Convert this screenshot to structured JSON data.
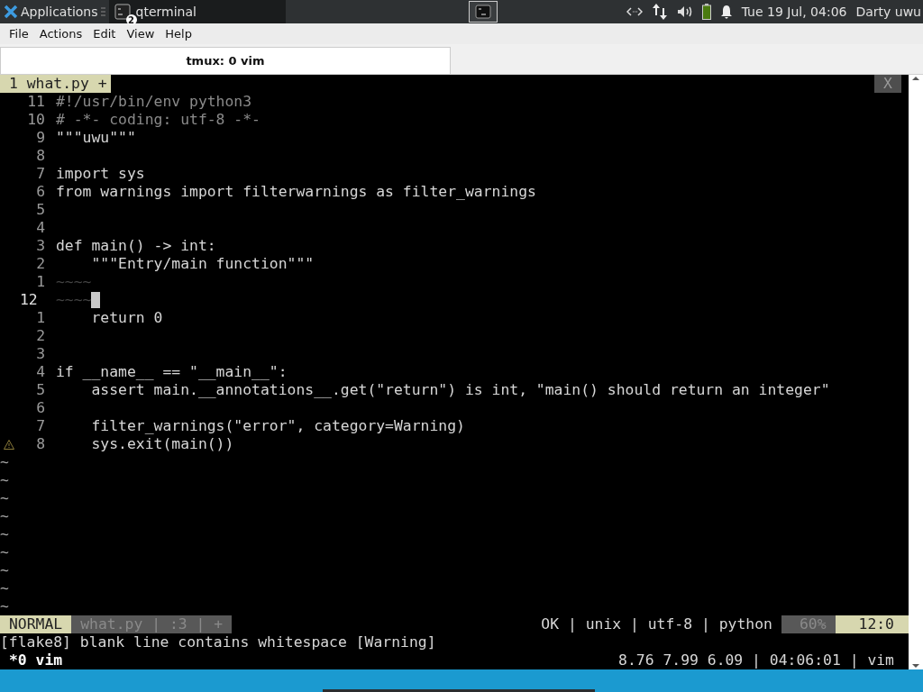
{
  "taskbar": {
    "menu_label": "Applications",
    "tasks": [
      {
        "label": "qterminal",
        "badge": "2",
        "selected": true
      }
    ],
    "clock": "Tue 19 Jul, 04:06",
    "user": "Darty uwu"
  },
  "window": {
    "menu": [
      "File",
      "Actions",
      "Edit",
      "View",
      "Help"
    ],
    "tabs": [
      {
        "label": "tmux: 0 vim",
        "selected": true
      }
    ]
  },
  "vim": {
    "buffer_tab": "1 what.py +",
    "close_label": "X",
    "lines": [
      {
        "number": "11",
        "text": "#!/usr/bin/env python3",
        "kind": "comment",
        "current": false
      },
      {
        "number": "10",
        "text": "# -*- coding: utf-8 -*-",
        "kind": "comment",
        "current": false
      },
      {
        "number": "9",
        "text": "\"\"\"uwu\"\"\"",
        "kind": "code",
        "current": false
      },
      {
        "number": "8",
        "current": false
      },
      {
        "number": "7",
        "text": "import sys",
        "kind": "code",
        "current": false
      },
      {
        "number": "6",
        "text": "from warnings import filterwarnings as filter_warnings",
        "kind": "code",
        "current": false
      },
      {
        "number": "5",
        "current": false
      },
      {
        "number": "4",
        "current": false
      },
      {
        "number": "3",
        "text": "def main() -> int:",
        "kind": "code",
        "current": false
      },
      {
        "number": "2",
        "text": "    \"\"\"Entry/main function\"\"\"",
        "kind": "code",
        "current": false
      },
      {
        "number": "1",
        "text": "~~~~",
        "kind": "whitespace",
        "current": false
      },
      {
        "number": "12",
        "text": "~~~~",
        "kind": "whitespace",
        "current": true
      },
      {
        "number": "1",
        "text": "    return 0",
        "kind": "code",
        "current": false
      },
      {
        "number": "2",
        "current": false
      },
      {
        "number": "3",
        "current": false
      },
      {
        "number": "4",
        "text": "if __name__ == \"__main__\":",
        "kind": "code",
        "current": false
      },
      {
        "number": "5",
        "text": "    assert main.__annotations__.get(\"return\") is int, \"main() should return an integer\"",
        "kind": "code",
        "current": false
      },
      {
        "number": "6",
        "current": false
      },
      {
        "number": "7",
        "text": "    filter_warnings(\"error\", category=Warning)",
        "kind": "code",
        "current": false
      },
      {
        "number": "8",
        "text": "    sys.exit(main())",
        "kind": "code",
        "current": false,
        "warning": true
      }
    ],
    "tildes": [
      "~",
      "~",
      "~",
      "~",
      "~",
      "~",
      "~",
      "~",
      "~"
    ],
    "statusline": {
      "mode": "NORMAL",
      "file_info": "what.py | :3 | +",
      "info": "OK | unix | utf-8 | python",
      "percent": "60%",
      "position": "12:0"
    },
    "message": "[flake8] blank line contains whitespace [Warning]"
  },
  "tmux": {
    "window": "*0 vim",
    "status": "8.76 7.99 6.09 | 04:06:01 | vim"
  }
}
